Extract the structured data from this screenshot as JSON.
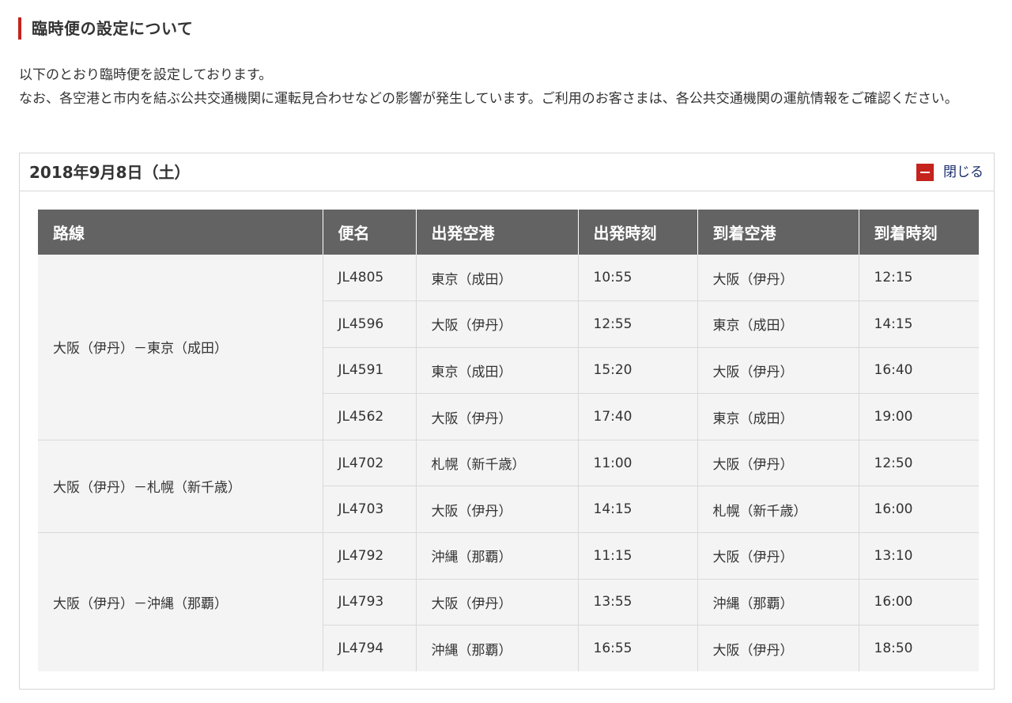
{
  "section": {
    "title": "臨時便の設定について"
  },
  "intro": {
    "line1": "以下のとおり臨時便を設定しております。",
    "line2": "なお、各空港と市内を結ぶ公共交通機関に運転見合わせなどの影響が発生しています。ご利用のお客さまは、各公共交通機関の運航情報をご確認ください。"
  },
  "panel": {
    "date": "2018年9月8日（土）",
    "toggle_label": "閉じる",
    "toggle_icon": "minus-icon",
    "accent_color": "#c4231e"
  },
  "table": {
    "headers": [
      "路線",
      "便名",
      "出発空港",
      "出発時刻",
      "到着空港",
      "到着時刻"
    ],
    "header_bg": "#636363",
    "routes": [
      {
        "route": "大阪（伊丹）－東京（成田）",
        "flights": [
          {
            "flight": "JL4805",
            "dep_airport": "東京（成田）",
            "dep_time": "10:55",
            "arr_airport": "大阪（伊丹）",
            "arr_time": "12:15"
          },
          {
            "flight": "JL4596",
            "dep_airport": "大阪（伊丹）",
            "dep_time": "12:55",
            "arr_airport": "東京（成田）",
            "arr_time": "14:15"
          },
          {
            "flight": "JL4591",
            "dep_airport": "東京（成田）",
            "dep_time": "15:20",
            "arr_airport": "大阪（伊丹）",
            "arr_time": "16:40"
          },
          {
            "flight": "JL4562",
            "dep_airport": "大阪（伊丹）",
            "dep_time": "17:40",
            "arr_airport": "東京（成田）",
            "arr_time": "19:00"
          }
        ]
      },
      {
        "route": "大阪（伊丹）－札幌（新千歳）",
        "flights": [
          {
            "flight": "JL4702",
            "dep_airport": "札幌（新千歳）",
            "dep_time": "11:00",
            "arr_airport": "大阪（伊丹）",
            "arr_time": "12:50"
          },
          {
            "flight": "JL4703",
            "dep_airport": "大阪（伊丹）",
            "dep_time": "14:15",
            "arr_airport": "札幌（新千歳）",
            "arr_time": "16:00"
          }
        ]
      },
      {
        "route": "大阪（伊丹）－沖縄（那覇）",
        "flights": [
          {
            "flight": "JL4792",
            "dep_airport": "沖縄（那覇）",
            "dep_time": "11:15",
            "arr_airport": "大阪（伊丹）",
            "arr_time": "13:10"
          },
          {
            "flight": "JL4793",
            "dep_airport": "大阪（伊丹）",
            "dep_time": "13:55",
            "arr_airport": "沖縄（那覇）",
            "arr_time": "16:00"
          },
          {
            "flight": "JL4794",
            "dep_airport": "沖縄（那覇）",
            "dep_time": "16:55",
            "arr_airport": "大阪（伊丹）",
            "arr_time": "18:50"
          }
        ]
      }
    ]
  }
}
